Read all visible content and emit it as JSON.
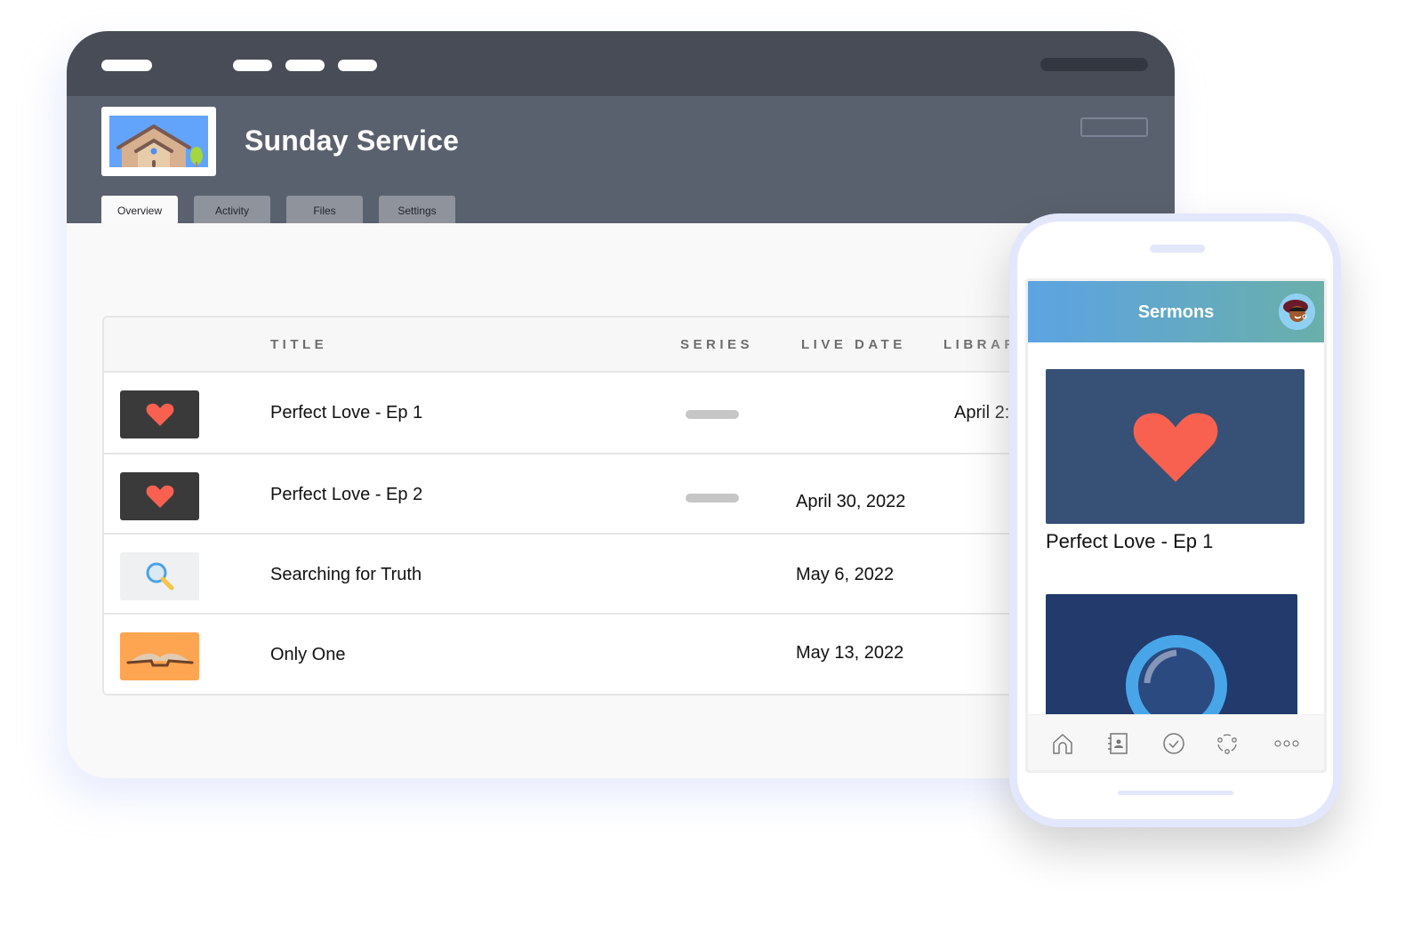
{
  "window": {
    "title": "Sunday Service",
    "tabs": [
      {
        "label": "Overview",
        "active": true
      },
      {
        "label": "Activity",
        "active": false
      },
      {
        "label": "Files",
        "active": false
      },
      {
        "label": "Settings",
        "active": false
      }
    ]
  },
  "table": {
    "columns": [
      "TITLE",
      "SERIES",
      "LIVE DATE",
      "LIBRAR"
    ],
    "rows": [
      {
        "thumbnail": "heart-icon",
        "title": "Perfect Love - Ep 1",
        "series": "placeholder",
        "live_date": "",
        "library": "April 2:"
      },
      {
        "thumbnail": "heart-icon",
        "title": "Perfect Love - Ep 2",
        "series": "placeholder",
        "live_date": "April 30, 2022",
        "library": ""
      },
      {
        "thumbnail": "magnifier-icon",
        "title": "Searching for Truth",
        "series": "",
        "live_date": "May 6, 2022",
        "library": ""
      },
      {
        "thumbnail": "open-book-icon",
        "title": "Only One",
        "series": "",
        "live_date": "May 13, 2022",
        "library": ""
      }
    ]
  },
  "phone": {
    "app_title": "Sermons",
    "cards": [
      {
        "title": "Perfect Love - Ep 1",
        "thumbnail": "heart-icon"
      },
      {
        "title": "",
        "thumbnail": "magnifier-icon"
      }
    ],
    "tabbar": [
      "home-icon",
      "directory-icon",
      "check-icon",
      "groups-icon",
      "more-icon"
    ]
  },
  "colors": {
    "topbar": "#484c57",
    "header": "#5a616e",
    "heart": "#f86150",
    "accent_gradient_start": "#5da3e2",
    "accent_gradient_end": "#69afaa"
  }
}
